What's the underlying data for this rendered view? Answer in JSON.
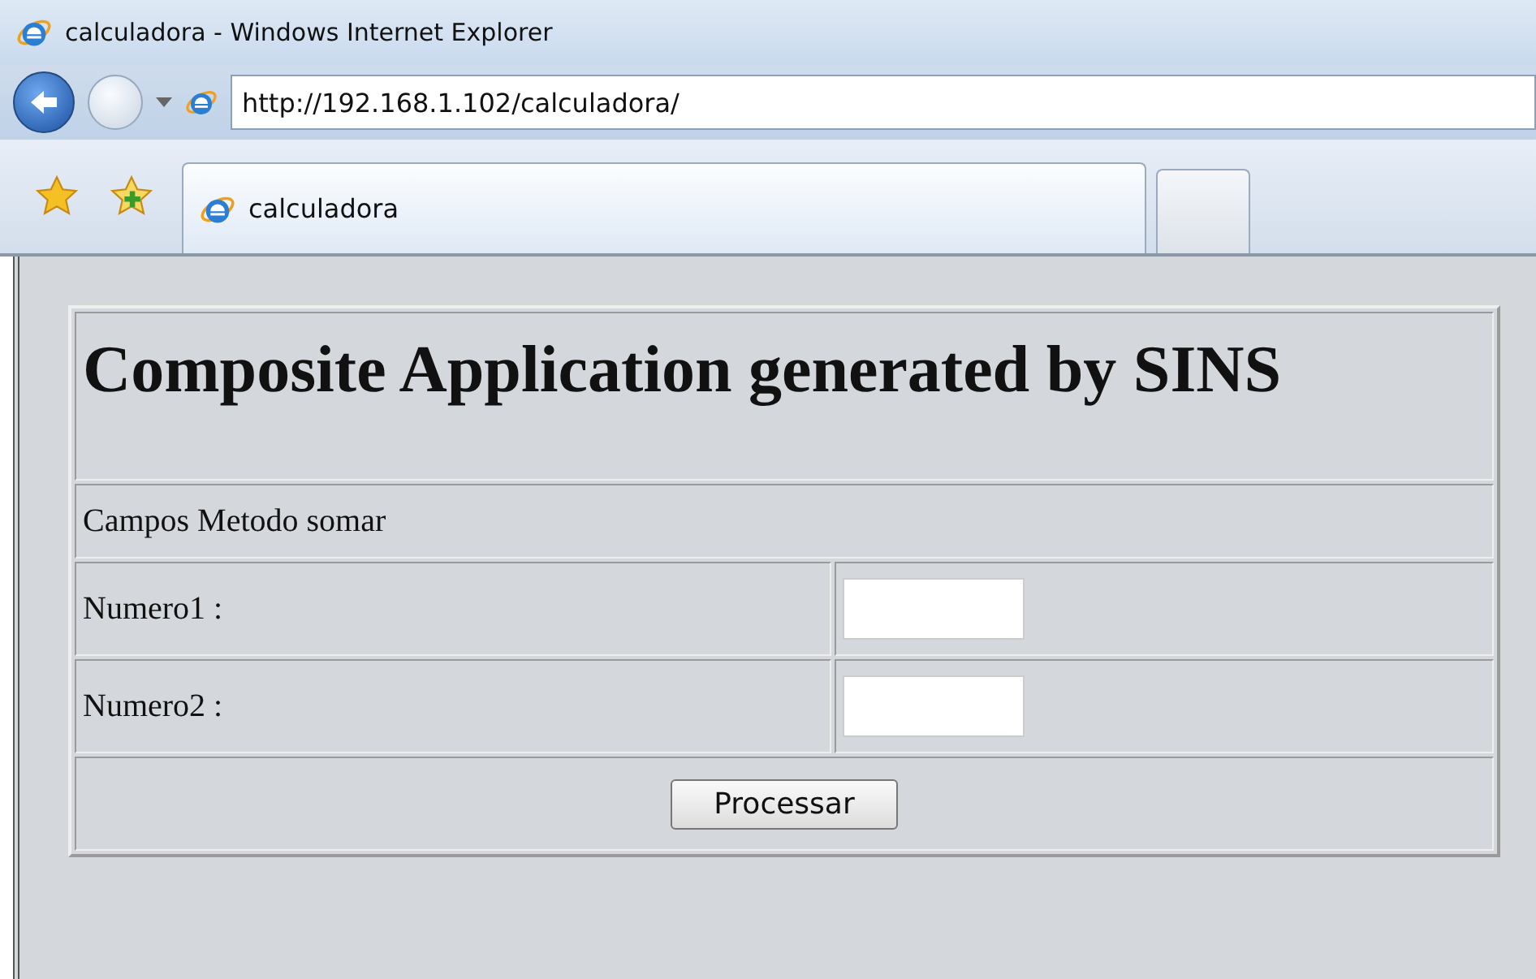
{
  "window": {
    "title": "calculadora - Windows Internet Explorer"
  },
  "address_bar": {
    "value": "http://192.168.1.102/calculadora/"
  },
  "tabs": [
    {
      "label": "calculadora",
      "selected": true
    }
  ],
  "page": {
    "heading": "Composite Application generated by SINS",
    "section": "Campos Metodo somar",
    "fields": [
      {
        "label": "Numero1 :"
      },
      {
        "label": "Numero2 :"
      }
    ],
    "button": "Processar"
  }
}
